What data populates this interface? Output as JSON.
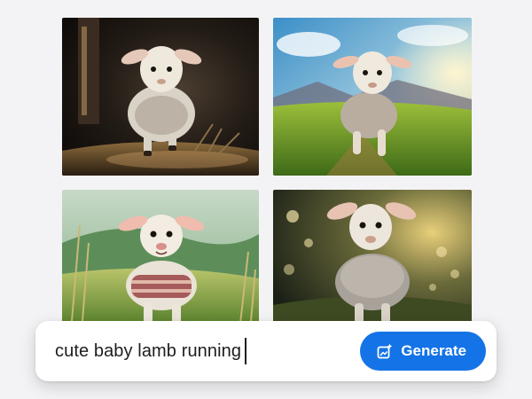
{
  "gallery": {
    "images": [
      {
        "icon": "lamb-image",
        "scene": "dark-studio"
      },
      {
        "icon": "lamb-image",
        "scene": "sunny-meadow"
      },
      {
        "icon": "lamb-image",
        "scene": "green-hills"
      },
      {
        "icon": "lamb-image",
        "scene": "bokeh-field"
      }
    ]
  },
  "prompt": {
    "value": "cute baby lamb running"
  },
  "generate": {
    "label": "Generate",
    "icon": "sparkle-image-icon",
    "color": "#1473e6"
  }
}
